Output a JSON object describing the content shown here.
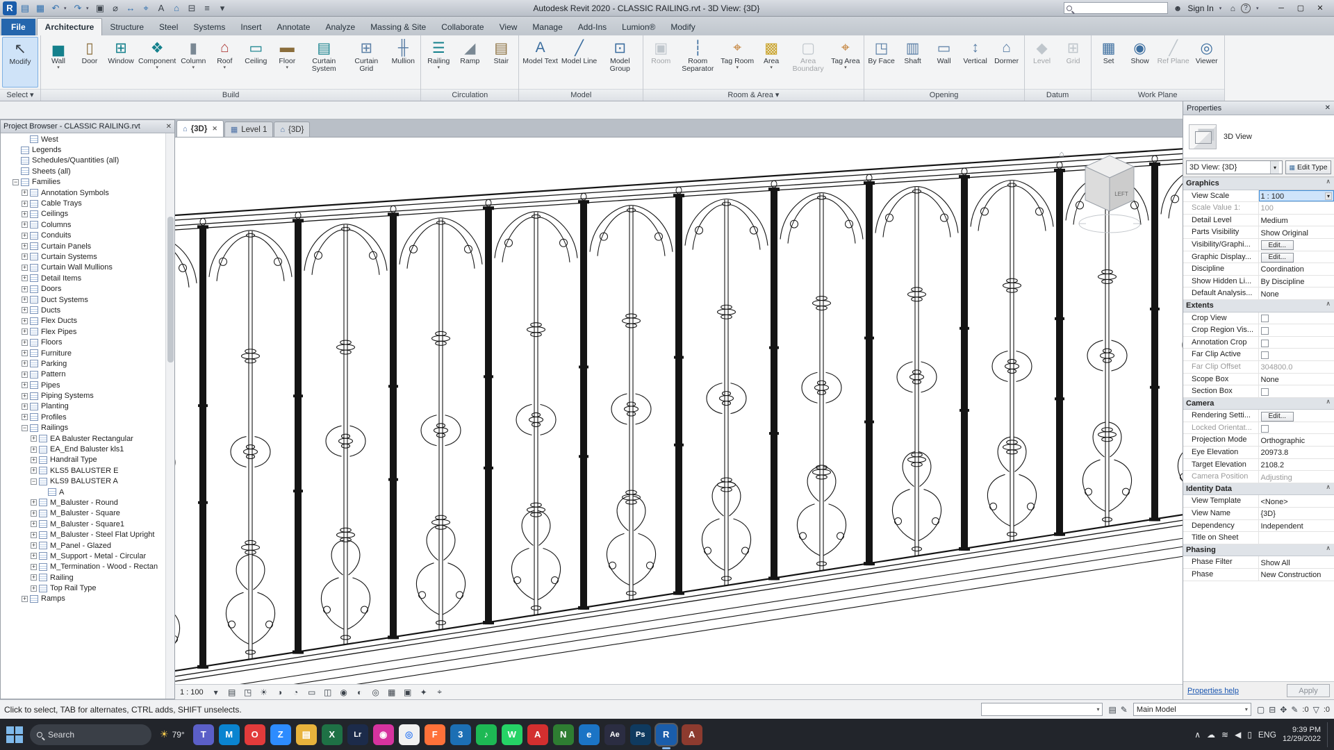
{
  "title_bar": {
    "title": "Autodesk Revit 2020 - CLASSIC RAILING.rvt - 3D View: {3D}",
    "qat": [
      {
        "name": "app-menu",
        "glyph": "R",
        "color": "#1a5dab"
      },
      {
        "name": "open",
        "glyph": "▤",
        "color": "#2f6fae"
      },
      {
        "name": "save",
        "glyph": "▦",
        "color": "#2f6fae"
      },
      {
        "name": "undo",
        "glyph": "↶",
        "color": "#2f6fae",
        "arrow": true
      },
      {
        "name": "redo",
        "glyph": "↷",
        "color": "#2f6fae",
        "arrow": true
      },
      {
        "name": "print",
        "glyph": "▣",
        "color": "#3c434b"
      },
      {
        "name": "measure",
        "glyph": "⌀",
        "color": "#3c434b"
      },
      {
        "name": "aligned-dimension",
        "glyph": "↔",
        "color": "#2f6fae"
      },
      {
        "name": "tag-by-category",
        "glyph": "⌖",
        "color": "#2f6fae"
      },
      {
        "name": "text",
        "glyph": "A",
        "color": "#3c434b"
      },
      {
        "name": "default-3d-view",
        "glyph": "⌂",
        "color": "#2f6fae"
      },
      {
        "name": "section",
        "glyph": "⊟",
        "color": "#3c434b"
      },
      {
        "name": "thin-lines",
        "glyph": "≡",
        "color": "#3c434b"
      },
      {
        "name": "customize-qat",
        "glyph": "▾",
        "color": "#3c434b"
      }
    ],
    "sign_in": "Sign In"
  },
  "ribbon": {
    "tabs": [
      {
        "label": "File",
        "file": true
      },
      {
        "label": "Architecture",
        "active": true
      },
      {
        "label": "Structure"
      },
      {
        "label": "Steel"
      },
      {
        "label": "Systems"
      },
      {
        "label": "Insert"
      },
      {
        "label": "Annotate"
      },
      {
        "label": "Analyze"
      },
      {
        "label": "Massing & Site"
      },
      {
        "label": "Collaborate"
      },
      {
        "label": "View"
      },
      {
        "label": "Manage"
      },
      {
        "label": "Add-Ins"
      },
      {
        "label": "Lumion®"
      },
      {
        "label": "Modify"
      }
    ],
    "panels": [
      {
        "label": "Select ▾",
        "buttons": [
          {
            "label": "Modify",
            "glyph": "↖",
            "color": "#3c434b",
            "selected": true,
            "wide": true
          }
        ]
      },
      {
        "label": "Build",
        "buttons": [
          {
            "label": "Wall",
            "glyph": "▅",
            "color": "#14808c",
            "arrow": true
          },
          {
            "label": "Door",
            "glyph": "▯",
            "color": "#8a6d3b"
          },
          {
            "label": "Window",
            "glyph": "⊞",
            "color": "#14808c"
          },
          {
            "label": "Component",
            "glyph": "❖",
            "color": "#14808c",
            "arrow": true
          },
          {
            "label": "Column",
            "glyph": "▮",
            "color": "#7a8894",
            "arrow": true
          },
          {
            "label": "Roof",
            "glyph": "⌂",
            "color": "#b0413e",
            "arrow": true
          },
          {
            "label": "Ceiling",
            "glyph": "▭",
            "color": "#14808c"
          },
          {
            "label": "Floor",
            "glyph": "▬",
            "color": "#8a6d3b",
            "arrow": true
          },
          {
            "label": "Curtain System",
            "glyph": "▤",
            "color": "#14808c"
          },
          {
            "label": "Curtain Grid",
            "glyph": "⊞",
            "color": "#5b7fa6"
          },
          {
            "label": "Mullion",
            "glyph": "╫",
            "color": "#5b7fa6"
          }
        ]
      },
      {
        "label": "Circulation",
        "buttons": [
          {
            "label": "Railing",
            "glyph": "☰",
            "color": "#14808c",
            "arrow": true
          },
          {
            "label": "Ramp",
            "glyph": "◢",
            "color": "#7a8894"
          },
          {
            "label": "Stair",
            "glyph": "▤",
            "color": "#8a6d3b"
          }
        ]
      },
      {
        "label": "Model",
        "buttons": [
          {
            "label": "Model Text",
            "glyph": "A",
            "color": "#3c6e9f"
          },
          {
            "label": "Model Line",
            "glyph": "╱",
            "color": "#3c6e9f"
          },
          {
            "label": "Model Group",
            "glyph": "⊡",
            "color": "#3c6e9f"
          }
        ]
      },
      {
        "label": "Room & Area ▾",
        "buttons": [
          {
            "label": "Room",
            "glyph": "▣",
            "color": "#7a8894",
            "disabled": true
          },
          {
            "label": "Room Separator",
            "glyph": "┆",
            "color": "#3c6e9f"
          },
          {
            "label": "Tag Room",
            "glyph": "⌖",
            "color": "#c07a2c",
            "arrow": true
          },
          {
            "label": "Area",
            "glyph": "▩",
            "color": "#c9a227",
            "arrow": true
          },
          {
            "label": "Area Boundary",
            "glyph": "▢",
            "color": "#7a8894",
            "disabled": true
          },
          {
            "label": "Tag Area",
            "glyph": "⌖",
            "color": "#c07a2c",
            "arrow": true
          }
        ]
      },
      {
        "label": "Opening",
        "buttons": [
          {
            "label": "By Face",
            "glyph": "◳",
            "color": "#5b7fa6"
          },
          {
            "label": "Shaft",
            "glyph": "▥",
            "color": "#5b7fa6"
          },
          {
            "label": "Wall",
            "glyph": "▭",
            "color": "#5b7fa6"
          },
          {
            "label": "Vertical",
            "glyph": "↕",
            "color": "#5b7fa6"
          },
          {
            "label": "Dormer",
            "glyph": "⌂",
            "color": "#5b7fa6"
          }
        ]
      },
      {
        "label": "Datum",
        "buttons": [
          {
            "label": "Level",
            "glyph": "◆",
            "color": "#7a8894",
            "disabled": true
          },
          {
            "label": "Grid",
            "glyph": "⊞",
            "color": "#7a8894",
            "disabled": true
          }
        ]
      },
      {
        "label": "Work Plane",
        "buttons": [
          {
            "label": "Set",
            "glyph": "▦",
            "color": "#3c6e9f"
          },
          {
            "label": "Show",
            "glyph": "◉",
            "color": "#3c6e9f"
          },
          {
            "label": "Ref Plane",
            "glyph": "╱",
            "color": "#7a8894",
            "disabled": true
          },
          {
            "label": "Viewer",
            "glyph": "◎",
            "color": "#3c6e9f"
          }
        ]
      }
    ]
  },
  "browser": {
    "title": "Project Browser - CLASSIC RAILING.rvt",
    "items": [
      {
        "label": "West",
        "depth": 2,
        "exp": "none"
      },
      {
        "label": "Legends",
        "depth": 1,
        "exp": "none"
      },
      {
        "label": "Schedules/Quantities (all)",
        "depth": 1,
        "exp": "none"
      },
      {
        "label": "Sheets (all)",
        "depth": 1,
        "exp": "none"
      },
      {
        "label": "Families",
        "depth": 1,
        "exp": "minus"
      },
      {
        "label": "Annotation Symbols",
        "depth": 2,
        "exp": "plus"
      },
      {
        "label": "Cable Trays",
        "depth": 2,
        "exp": "plus"
      },
      {
        "label": "Ceilings",
        "depth": 2,
        "exp": "plus"
      },
      {
        "label": "Columns",
        "depth": 2,
        "exp": "plus"
      },
      {
        "label": "Conduits",
        "depth": 2,
        "exp": "plus"
      },
      {
        "label": "Curtain Panels",
        "depth": 2,
        "exp": "plus"
      },
      {
        "label": "Curtain Systems",
        "depth": 2,
        "exp": "plus"
      },
      {
        "label": "Curtain Wall Mullions",
        "depth": 2,
        "exp": "plus"
      },
      {
        "label": "Detail Items",
        "depth": 2,
        "exp": "plus"
      },
      {
        "label": "Doors",
        "depth": 2,
        "exp": "plus"
      },
      {
        "label": "Duct Systems",
        "depth": 2,
        "exp": "plus"
      },
      {
        "label": "Ducts",
        "depth": 2,
        "exp": "plus"
      },
      {
        "label": "Flex Ducts",
        "depth": 2,
        "exp": "plus"
      },
      {
        "label": "Flex Pipes",
        "depth": 2,
        "exp": "plus"
      },
      {
        "label": "Floors",
        "depth": 2,
        "exp": "plus"
      },
      {
        "label": "Furniture",
        "depth": 2,
        "exp": "plus"
      },
      {
        "label": "Parking",
        "depth": 2,
        "exp": "plus"
      },
      {
        "label": "Pattern",
        "depth": 2,
        "exp": "plus"
      },
      {
        "label": "Pipes",
        "depth": 2,
        "exp": "plus"
      },
      {
        "label": "Piping Systems",
        "depth": 2,
        "exp": "plus"
      },
      {
        "label": "Planting",
        "depth": 2,
        "exp": "plus"
      },
      {
        "label": "Profiles",
        "depth": 2,
        "exp": "plus"
      },
      {
        "label": "Railings",
        "depth": 2,
        "exp": "minus"
      },
      {
        "label": "EA Baluster Rectangular",
        "depth": 3,
        "exp": "plus"
      },
      {
        "label": "EA_End Baluster kls1",
        "depth": 3,
        "exp": "plus"
      },
      {
        "label": "Handrail Type",
        "depth": 3,
        "exp": "plus"
      },
      {
        "label": "KLS5 BALUSTER E",
        "depth": 3,
        "exp": "plus"
      },
      {
        "label": "KLS9 BALUSTER A",
        "depth": 3,
        "exp": "minus"
      },
      {
        "label": "A",
        "depth": 4,
        "exp": "none"
      },
      {
        "label": "M_Baluster - Round",
        "depth": 3,
        "exp": "plus"
      },
      {
        "label": "M_Baluster - Square",
        "depth": 3,
        "exp": "plus"
      },
      {
        "label": "M_Baluster - Square1",
        "depth": 3,
        "exp": "plus"
      },
      {
        "label": "M_Baluster - Steel Flat Upright",
        "depth": 3,
        "exp": "plus"
      },
      {
        "label": "M_Panel - Glazed",
        "depth": 3,
        "exp": "plus"
      },
      {
        "label": "M_Support - Metal - Circular",
        "depth": 3,
        "exp": "plus"
      },
      {
        "label": "M_Termination - Wood - Rectan",
        "depth": 3,
        "exp": "plus"
      },
      {
        "label": "Railing",
        "depth": 3,
        "exp": "plus"
      },
      {
        "label": "Top Rail Type",
        "depth": 3,
        "exp": "plus"
      },
      {
        "label": "Ramps",
        "depth": 2,
        "exp": "plus"
      }
    ]
  },
  "view_tabs": [
    {
      "label": "{3D}",
      "icon": "⌂",
      "active": true,
      "close": true
    },
    {
      "label": "Level 1",
      "icon": "▦",
      "active": false,
      "close": false
    },
    {
      "label": "{3D}",
      "icon": "⌂",
      "active": false,
      "close": false
    }
  ],
  "viewcube": {
    "face_label": "LEFT"
  },
  "view_bar": {
    "scale": "1 : 100",
    "icons": [
      {
        "name": "scale-menu",
        "glyph": "▾"
      },
      {
        "name": "detail-level",
        "glyph": "▤"
      },
      {
        "name": "visual-style",
        "glyph": "◳"
      },
      {
        "name": "sun-path",
        "glyph": "☀"
      },
      {
        "name": "shadows",
        "glyph": "◑"
      },
      {
        "name": "rendering-dialog",
        "glyph": "◔"
      },
      {
        "name": "crop-view",
        "glyph": "▭"
      },
      {
        "name": "crop-region-visibility",
        "glyph": "◫"
      },
      {
        "name": "locked-3d-view",
        "glyph": "◉"
      },
      {
        "name": "temporary-hide-isolate",
        "glyph": "◐"
      },
      {
        "name": "reveal-hidden-elements",
        "glyph": "◎"
      },
      {
        "name": "worksharing-display",
        "glyph": "▦"
      },
      {
        "name": "temporary-view-properties",
        "glyph": "▣"
      },
      {
        "name": "displacement-sets",
        "glyph": "✦"
      },
      {
        "name": "reveal-constraints",
        "glyph": "⌖"
      }
    ]
  },
  "properties": {
    "header": "Properties",
    "category": "3D View",
    "type_selector": "3D View: {3D}",
    "edit_type": "Edit Type",
    "sections": [
      {
        "title": "Graphics",
        "rows": [
          {
            "label": "View Scale",
            "value": "1 : 100",
            "type": "combo-open"
          },
          {
            "label": "Scale Value    1:",
            "value": "100",
            "disabled": true
          },
          {
            "label": "Detail Level",
            "value": "Medium"
          },
          {
            "label": "Parts Visibility",
            "value": "Show Original"
          },
          {
            "label": "Visibility/Graphi...",
            "value": "Edit...",
            "type": "button"
          },
          {
            "label": "Graphic Display...",
            "value": "Edit...",
            "type": "button"
          },
          {
            "label": "Discipline",
            "value": "Coordination"
          },
          {
            "label": "Show Hidden Li...",
            "value": "By Discipline"
          },
          {
            "label": "Default Analysis...",
            "value": "None"
          }
        ]
      },
      {
        "title": "Extents",
        "rows": [
          {
            "label": "Crop View",
            "type": "check"
          },
          {
            "label": "Crop Region Vis...",
            "type": "check"
          },
          {
            "label": "Annotation Crop",
            "type": "check"
          },
          {
            "label": "Far Clip Active",
            "type": "check"
          },
          {
            "label": "Far Clip Offset",
            "value": "304800.0",
            "disabled": true
          },
          {
            "label": "Scope Box",
            "value": "None"
          },
          {
            "label": "Section Box",
            "type": "check"
          }
        ]
      },
      {
        "title": "Camera",
        "rows": [
          {
            "label": "Rendering Setti...",
            "value": "Edit...",
            "type": "button"
          },
          {
            "label": "Locked Orientat...",
            "type": "check",
            "disabled": true
          },
          {
            "label": "Projection Mode",
            "value": "Orthographic"
          },
          {
            "label": "Eye Elevation",
            "value": "20973.8"
          },
          {
            "label": "Target Elevation",
            "value": "2108.2"
          },
          {
            "label": "Camera Position",
            "value": "Adjusting",
            "disabled": true
          }
        ]
      },
      {
        "title": "Identity Data",
        "rows": [
          {
            "label": "View Template",
            "value": "<None>"
          },
          {
            "label": "View Name",
            "value": "{3D}"
          },
          {
            "label": "Dependency",
            "value": "Independent"
          },
          {
            "label": "Title on Sheet",
            "value": ""
          }
        ]
      },
      {
        "title": "Phasing",
        "rows": [
          {
            "label": "Phase Filter",
            "value": "Show All"
          },
          {
            "label": "Phase",
            "value": "New Construction"
          }
        ]
      }
    ],
    "help_link": "Properties help",
    "apply": "Apply"
  },
  "status_bar": {
    "message": "Click to select, TAB for alternates, CTRL adds, SHIFT unselects.",
    "workset_combo": "",
    "design_option_combo": "Main Model",
    "icons_mid": [
      {
        "name": "worksets",
        "glyph": "▤"
      },
      {
        "name": "editing-requests",
        "glyph": "✎"
      }
    ],
    "icons_right": [
      {
        "name": "active-only",
        "glyph": "▢"
      },
      {
        "name": "exclude-options",
        "glyph": "⊟"
      },
      {
        "name": "press-drag",
        "glyph": "✥"
      }
    ],
    "counters": [
      {
        "name": "editable-only-count",
        "glyph": "✎",
        "count": ":0"
      },
      {
        "name": "filter-count",
        "glyph": "▽",
        "count": ":0"
      }
    ]
  },
  "taskbar": {
    "search_placeholder": "Search",
    "weather": "79°",
    "apps": [
      {
        "name": "teams",
        "glyph": "T",
        "bg": "#5b5fc7"
      },
      {
        "name": "messages",
        "glyph": "M",
        "bg": "#0a84d0"
      },
      {
        "name": "opera",
        "glyph": "O",
        "bg": "#e23b3b"
      },
      {
        "name": "zoom",
        "glyph": "Z",
        "bg": "#2d8cff"
      },
      {
        "name": "file-explorer",
        "glyph": "▤",
        "bg": "#e8b33c"
      },
      {
        "name": "excel",
        "glyph": "X",
        "bg": "#1e7145"
      },
      {
        "name": "lightroom",
        "glyph": "Lr",
        "bg": "#1c2b4a"
      },
      {
        "name": "instagram",
        "glyph": "◉",
        "bg": "#d6339f"
      },
      {
        "name": "chrome",
        "glyph": "◎",
        "bg": "#f1f1f1",
        "fg": "#4285f4"
      },
      {
        "name": "firefox",
        "glyph": "F",
        "bg": "#ff7139"
      },
      {
        "name": "3ds-max",
        "glyph": "3",
        "bg": "#1c6fb4"
      },
      {
        "name": "spotify",
        "glyph": "♪",
        "bg": "#1db954"
      },
      {
        "name": "whatsapp",
        "glyph": "W",
        "bg": "#25d366"
      },
      {
        "name": "acrobat",
        "glyph": "A",
        "bg": "#d32f2f"
      },
      {
        "name": "navisworks",
        "glyph": "N",
        "bg": "#2e7d32"
      },
      {
        "name": "internet-explorer",
        "glyph": "e",
        "bg": "#1b74c5"
      },
      {
        "name": "after-effects",
        "glyph": "Ae",
        "bg": "#2b2d42"
      },
      {
        "name": "photoshop",
        "glyph": "Ps",
        "bg": "#0f3a5f"
      },
      {
        "name": "revit",
        "glyph": "R",
        "bg": "#1a5dab",
        "active": true
      },
      {
        "name": "autocad",
        "glyph": "A",
        "bg": "#8d3b2f"
      }
    ],
    "tray": {
      "chevron": "∧",
      "cloud": "☁",
      "network": "≋",
      "sound": "◀",
      "battery": "▯",
      "lang": "ENG",
      "time": "9:39 PM",
      "date": "12/29/2022"
    }
  }
}
